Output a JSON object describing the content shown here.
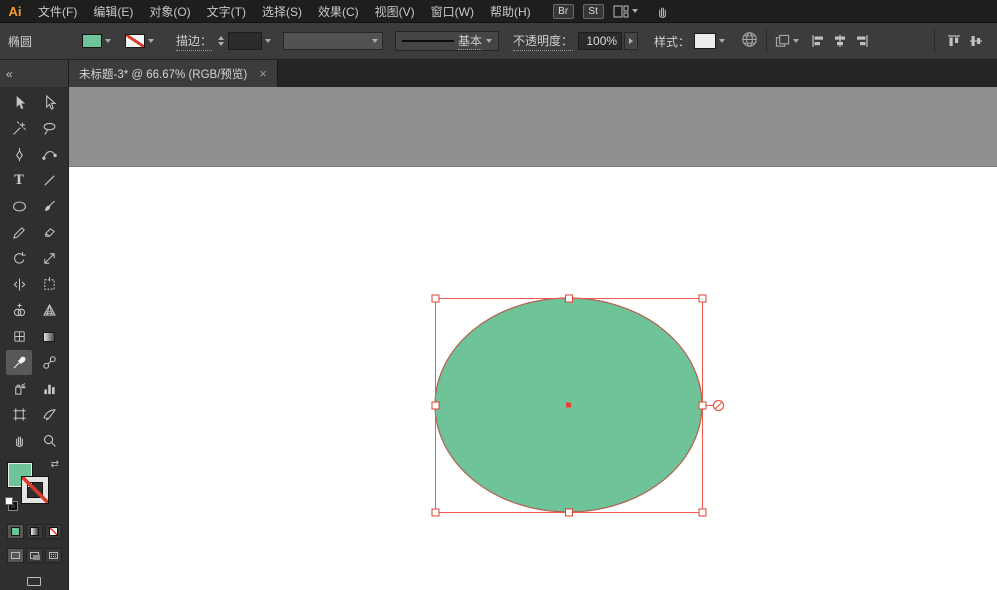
{
  "colors": {
    "ellipse_fill": "#6ec399",
    "ellipse_edge": "#b4604e",
    "selection_red": "#ef5a4c",
    "handle_border": "#d84537",
    "center_dot": "#e8402f",
    "canvas_gray": "#8f8f8f",
    "artboard_white": "#ffffff",
    "menubar_bg": "#1e1e1e",
    "panel_bg": "#3c3c3c",
    "logo_orange": "#f79a28"
  },
  "menubar": {
    "logo": "Ai",
    "items": [
      {
        "label": "文件(F)"
      },
      {
        "label": "编辑(E)"
      },
      {
        "label": "对象(O)"
      },
      {
        "label": "文字(T)"
      },
      {
        "label": "选择(S)"
      },
      {
        "label": "效果(C)"
      },
      {
        "label": "视图(V)"
      },
      {
        "label": "窗口(W)"
      },
      {
        "label": "帮助(H)"
      }
    ],
    "badges": [
      {
        "label": "Br"
      },
      {
        "label": "St"
      }
    ]
  },
  "control_bar": {
    "context_label": "椭圆",
    "stroke_label": "描边：",
    "stroke_width_value": "",
    "stroke_style_label": "基本",
    "opacity_label": "不透明度：",
    "opacity_value": "100%",
    "style_label": "样式："
  },
  "tab_bar": {
    "collapse_glyph": "«",
    "tab_title": "未标题-3* @ 66.67% (RGB/预览)",
    "close_glyph": "×"
  },
  "icons": {
    "swap_glyph": "⇄"
  }
}
